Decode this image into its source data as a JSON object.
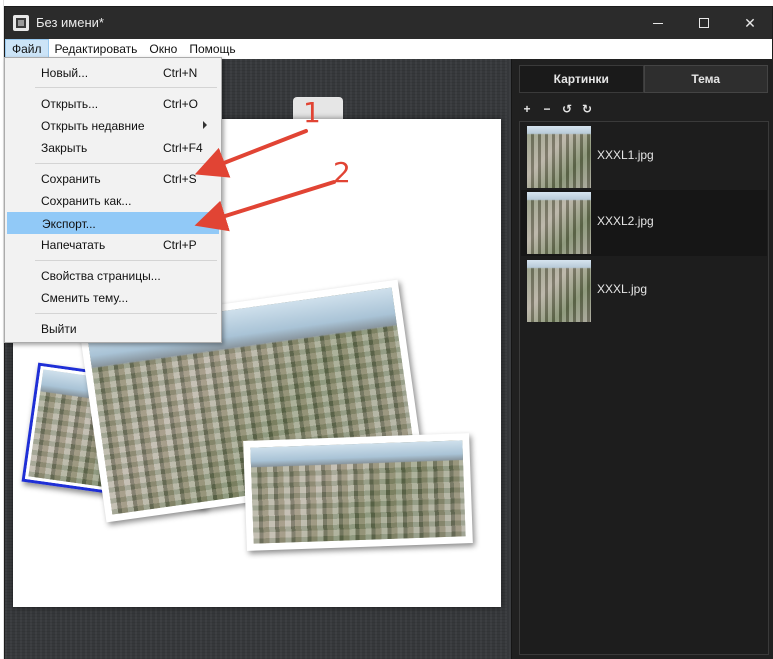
{
  "window": {
    "title": "Без имени*"
  },
  "menubar": [
    {
      "name": "menu-file",
      "label": "Файл"
    },
    {
      "name": "menu-edit",
      "label": "Редактировать"
    },
    {
      "name": "menu-window",
      "label": "Окно"
    },
    {
      "name": "menu-help",
      "label": "Помощь"
    }
  ],
  "file_menu": {
    "new": {
      "label": "Новый...",
      "shortcut": "Ctrl+N"
    },
    "open": {
      "label": "Открыть...",
      "shortcut": "Ctrl+O"
    },
    "open_recent": {
      "label": "Открыть недавние",
      "has_submenu": true
    },
    "close": {
      "label": "Закрыть",
      "shortcut": "Ctrl+F4"
    },
    "save": {
      "label": "Сохранить",
      "shortcut": "Ctrl+S"
    },
    "save_as": {
      "label": "Сохранить как..."
    },
    "export": {
      "label": "Экспорт...",
      "highlighted": true
    },
    "print": {
      "label": "Напечатать",
      "shortcut": "Ctrl+P"
    },
    "page_props": {
      "label": "Свойства страницы..."
    },
    "change_theme": {
      "label": "Сменить тему..."
    },
    "exit": {
      "label": "Выйти"
    }
  },
  "right_panel": {
    "tabs": [
      {
        "label": "Картинки",
        "active": true
      },
      {
        "label": "Тема",
        "active": false
      }
    ],
    "tools": [
      "add-icon",
      "remove-icon",
      "rotate-left-icon",
      "rotate-right-icon"
    ],
    "images": [
      {
        "name": "XXXL1.jpg",
        "selected": false
      },
      {
        "name": "XXXL2.jpg",
        "selected": true
      },
      {
        "name": "XXXL.jpg",
        "selected": false
      }
    ]
  },
  "annotations": {
    "step1": "1",
    "step2": "2",
    "color": "#e14434"
  },
  "colors": {
    "menu_highlight": "#91c9f7",
    "selected_photo_border": "#1f2fd6",
    "panel_bg": "#202020"
  }
}
